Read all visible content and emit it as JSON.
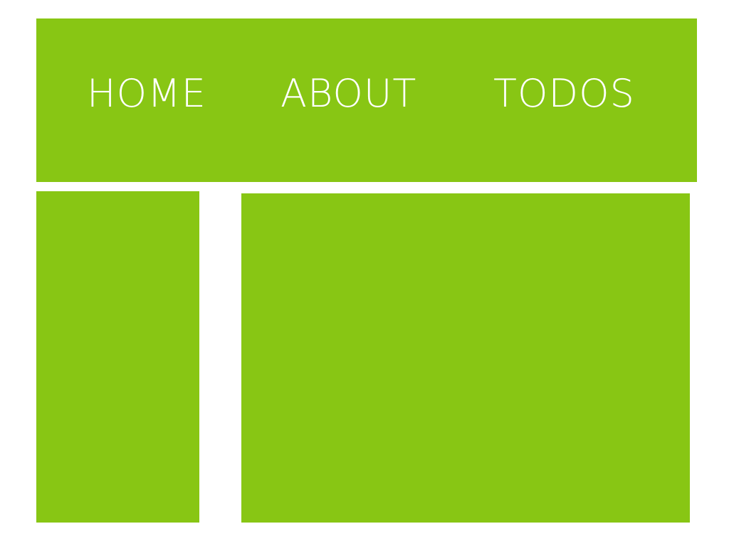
{
  "nav": {
    "items": [
      {
        "label": "HOME"
      },
      {
        "label": "ABOUT"
      },
      {
        "label": "TODOS"
      }
    ]
  },
  "colors": {
    "panel": "#88c614",
    "text": "#ffffff",
    "background": "#ffffff"
  }
}
